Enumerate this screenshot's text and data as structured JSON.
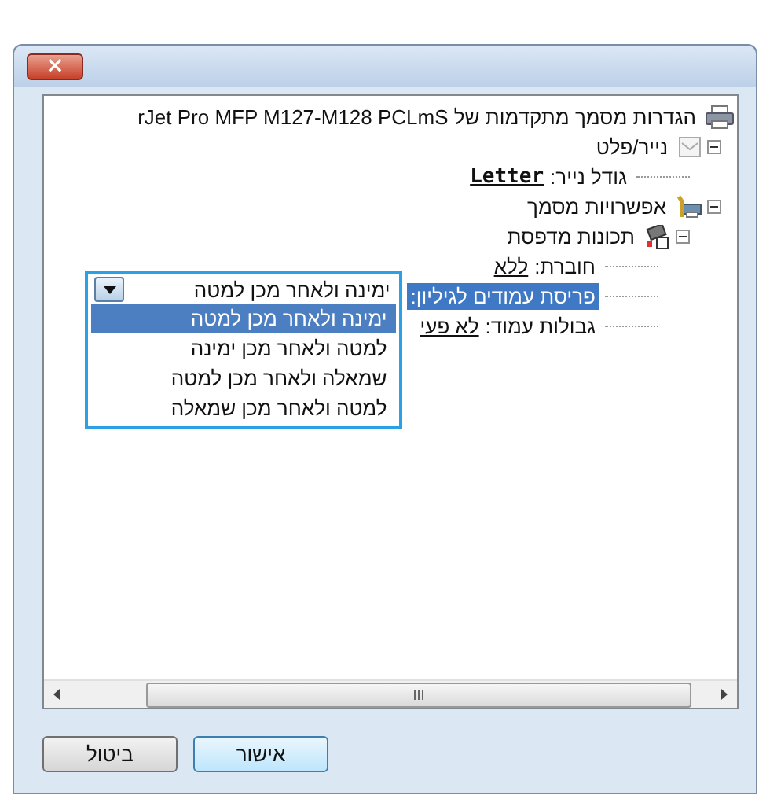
{
  "window": {
    "close_label": "×"
  },
  "tree": [
    {
      "kind": "group",
      "label": "הגדרות מסמך מתקדמות של rJet Pro MFP M127-M128 PCLmS",
      "children": [
        {
          "kind": "group",
          "label": "נייר/פלט",
          "expanded": true,
          "children": [
            {
              "kind": "setting",
              "label": "גודל נייר:",
              "value": "Letter",
              "emphasized": true,
              "selected": false
            }
          ]
        },
        {
          "kind": "group",
          "label": "אפשרויות מסמך",
          "expanded": true,
          "children": [
            {
              "kind": "group",
              "label": "תכונות מדפסת",
              "expanded": true,
              "children": [
                {
                  "kind": "setting",
                  "label": "חוברת:",
                  "value": "ללא",
                  "emphasized": false,
                  "selected": false
                },
                {
                  "kind": "setting",
                  "label": "פריסת עמודים לגיליון:",
                  "selected": true,
                  "dropdown": {
                    "value": "ימינה ולאחר מכן למטה",
                    "options": [
                      {
                        "label": "ימינה ולאחר מכן למטה",
                        "selected": true
                      },
                      {
                        "label": "למטה ולאחר מכן ימינה",
                        "selected": false
                      },
                      {
                        "label": "שמאלה ולאחר מכן למטה",
                        "selected": false
                      },
                      {
                        "label": "למטה ולאחר מכן שמאלה",
                        "selected": false
                      }
                    ]
                  }
                },
                {
                  "kind": "setting",
                  "label": "גבולות עמוד:",
                  "value": "לא פעי",
                  "emphasized": false,
                  "selected": false
                }
              ]
            }
          ]
        }
      ]
    }
  ],
  "buttons": [
    {
      "label": "אישור",
      "default": true
    },
    {
      "label": "ביטול",
      "default": false
    }
  ]
}
